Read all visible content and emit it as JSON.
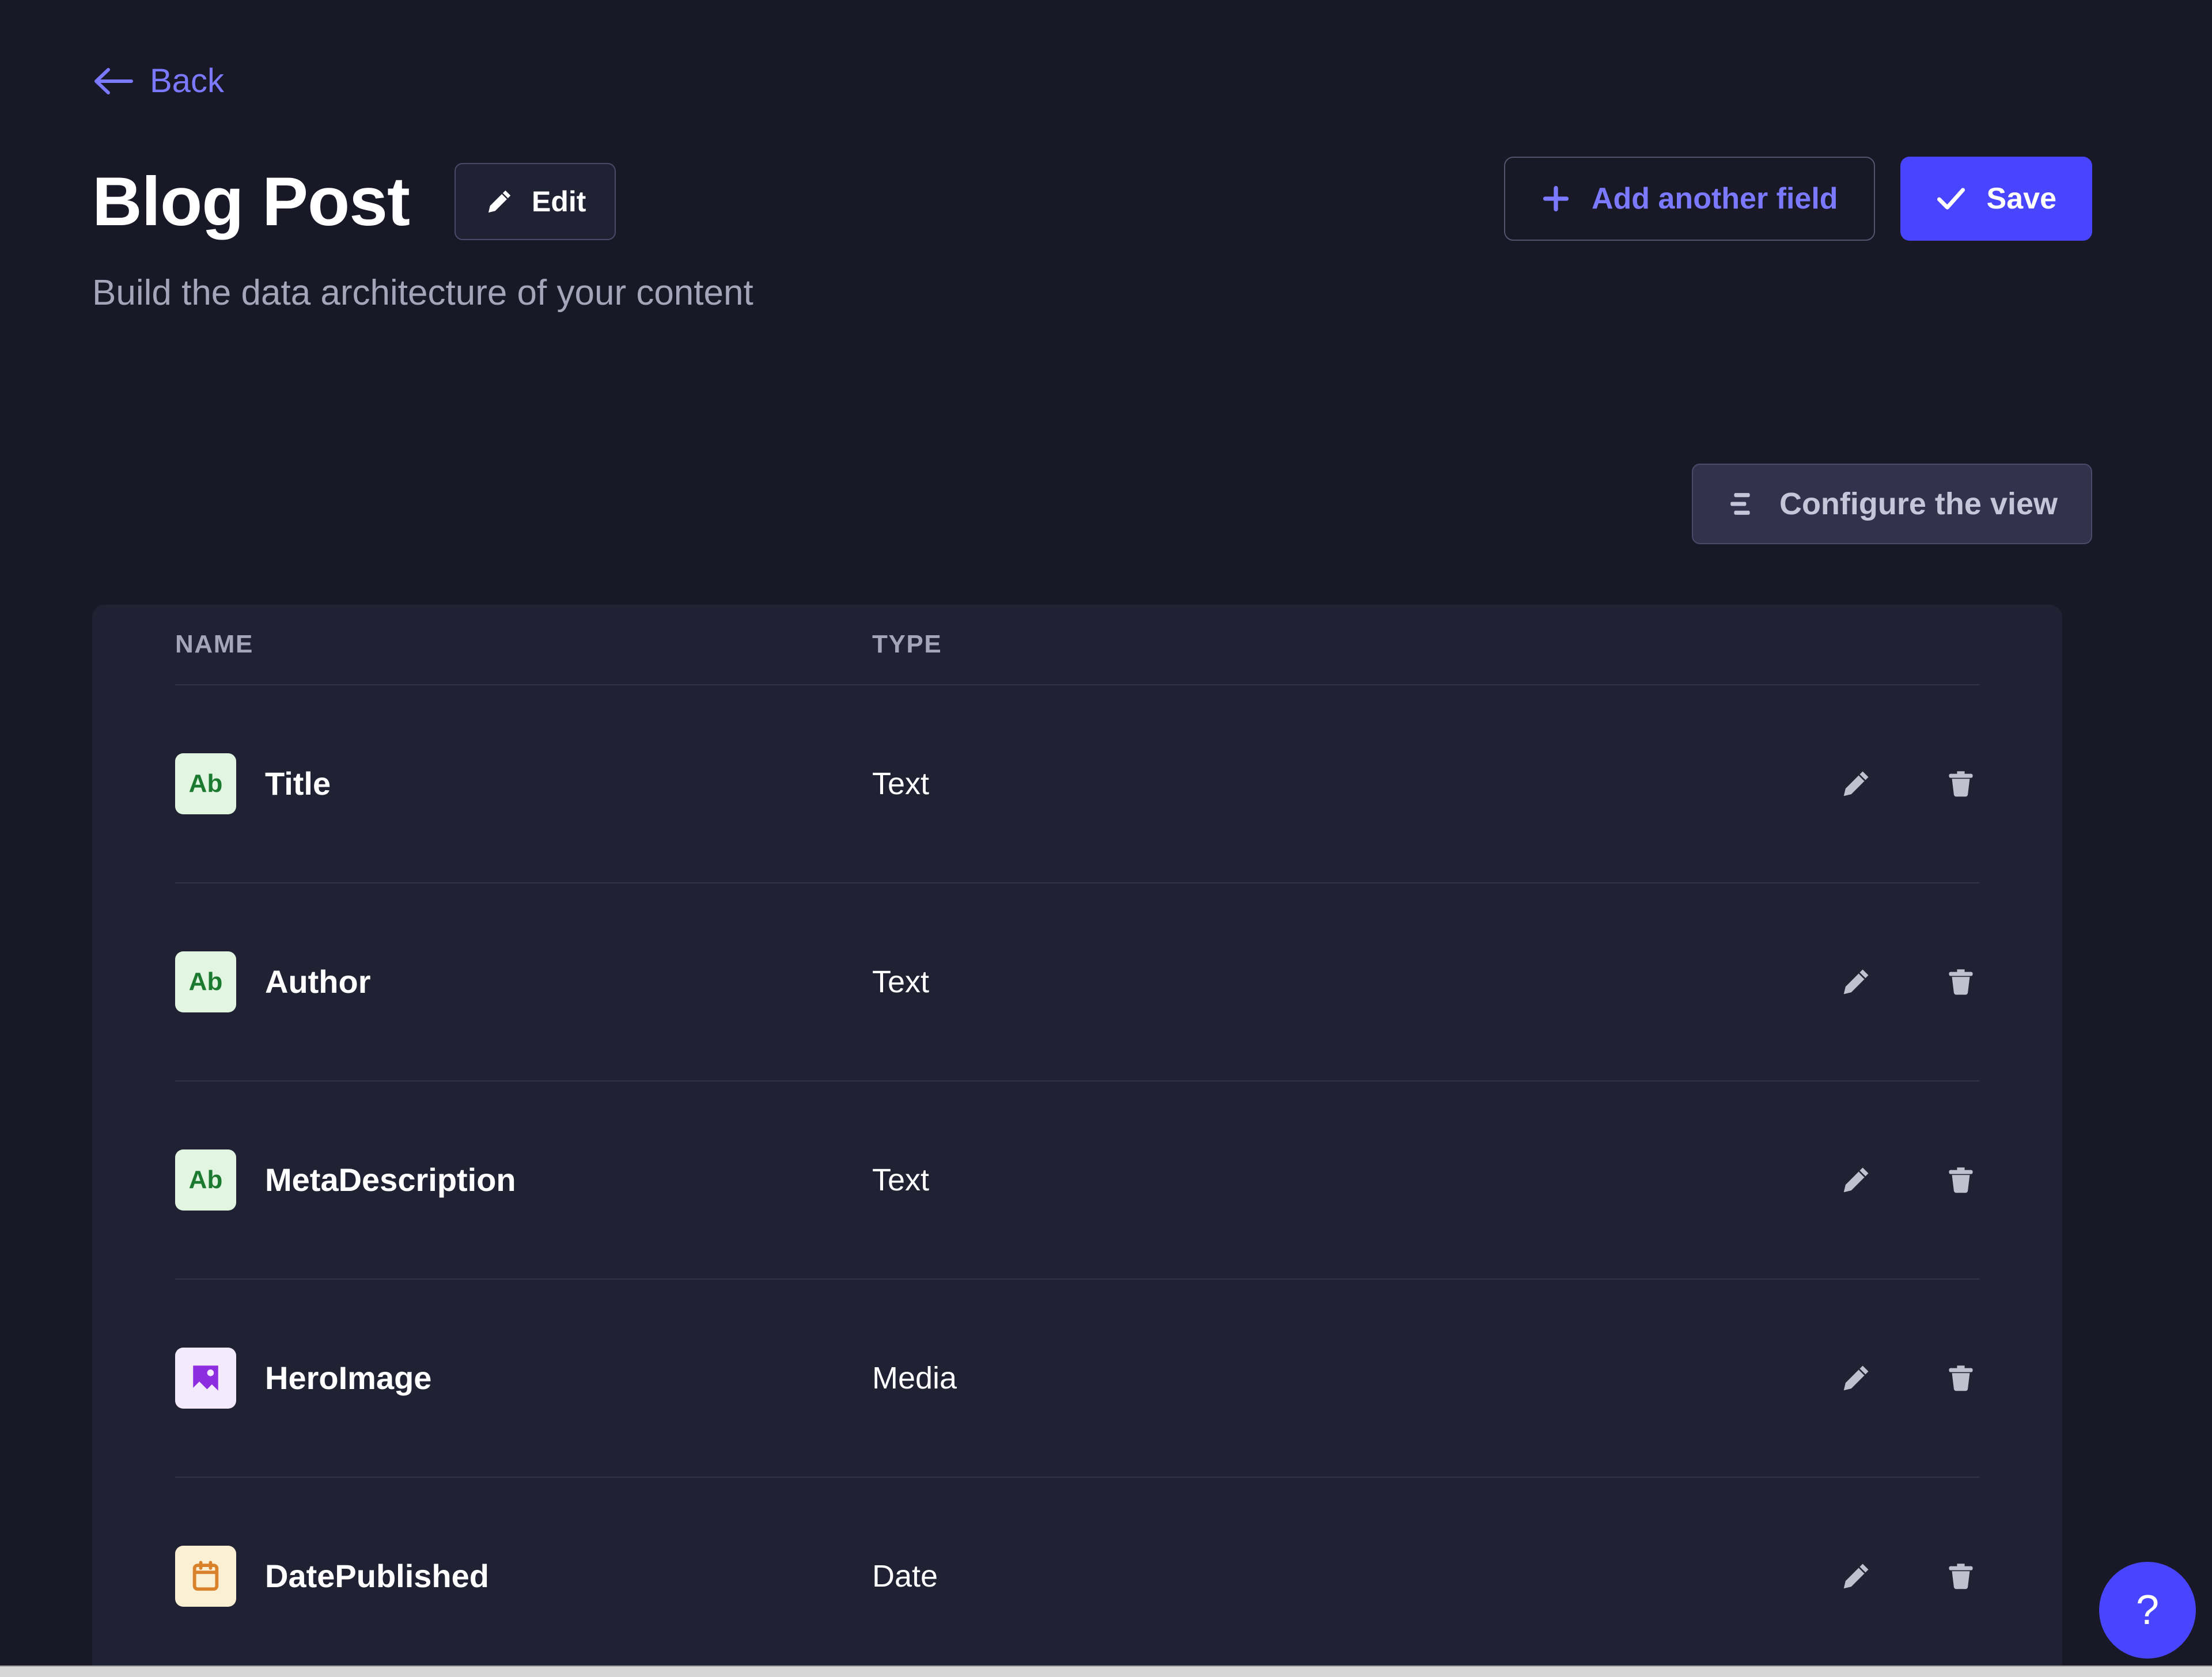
{
  "theme": {
    "page_bg": "#181826",
    "card_bg": "#212134",
    "accent": "#4945ff",
    "link": "#7b79ff",
    "muted_text": "#a5a5ba",
    "divider": "#32324d"
  },
  "header": {
    "back_label": "Back",
    "title": "Blog Post",
    "edit_label": "Edit",
    "subtitle": "Build the data architecture of your content",
    "add_field_label": "Add another field",
    "save_label": "Save"
  },
  "toolbar": {
    "configure_label": "Configure the view"
  },
  "table": {
    "columns": {
      "name": "NAME",
      "type": "TYPE"
    },
    "rows": [
      {
        "name": "Title",
        "type": "Text",
        "icon": "text-badge-icon",
        "badge_text": "Ab",
        "badge_bg": "#e2f5e1",
        "badge_fg": "#1b7a2f"
      },
      {
        "name": "Author",
        "type": "Text",
        "icon": "text-badge-icon",
        "badge_text": "Ab",
        "badge_bg": "#e2f5e1",
        "badge_fg": "#1b7a2f"
      },
      {
        "name": "MetaDescription",
        "type": "Text",
        "icon": "text-badge-icon",
        "badge_text": "Ab",
        "badge_bg": "#e2f5e1",
        "badge_fg": "#1b7a2f"
      },
      {
        "name": "HeroImage",
        "type": "Media",
        "icon": "media-badge-icon",
        "badge_text": "",
        "badge_bg": "#f4eafe",
        "badge_fg": "#8c2ee0"
      },
      {
        "name": "DatePublished",
        "type": "Date",
        "icon": "date-badge-icon",
        "badge_text": "",
        "badge_bg": "#fbefd4",
        "badge_fg": "#d9822b"
      }
    ],
    "row_actions": {
      "edit": "edit-row-icon",
      "delete": "delete-row-icon"
    }
  },
  "help": {
    "label": "?"
  }
}
